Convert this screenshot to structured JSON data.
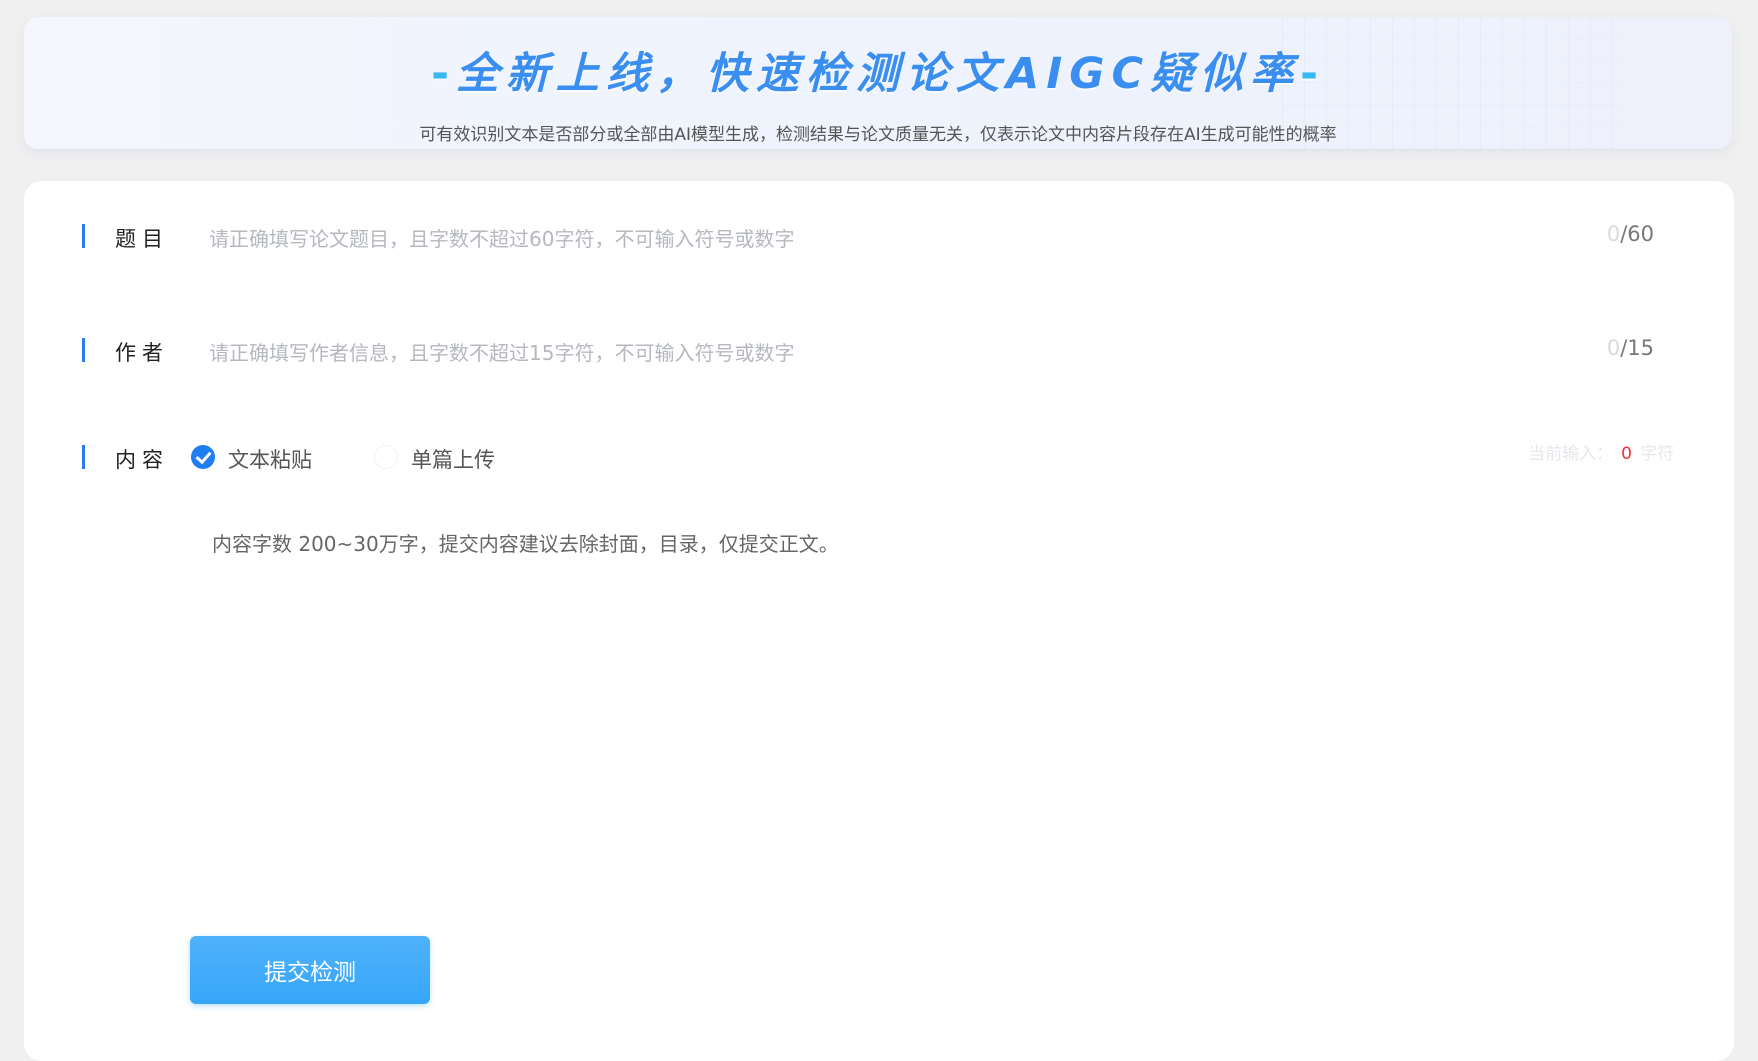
{
  "banner": {
    "title_dash_left": "-",
    "title": "全新上线，快速检测论文AIGC疑似率",
    "title_dash_right": "-",
    "subtitle": "可有效识别文本是否部分或全部由AI模型生成，检测结果与论文质量无关，仅表示论文中内容片段存在AI生成可能性的概率"
  },
  "form": {
    "title_field": {
      "label": "题目",
      "placeholder": "请正确填写论文题目，且字数不超过60字符，不可输入符号或数字",
      "current": "0",
      "max": "/60"
    },
    "author_field": {
      "label": "作者",
      "placeholder": "请正确填写作者信息，且字数不超过15字符，不可输入符号或数字",
      "current": "0",
      "max": "/15"
    },
    "content_field": {
      "label": "内容",
      "options": [
        {
          "label": "文本粘贴",
          "selected": true
        },
        {
          "label": "单篇上传",
          "selected": false
        }
      ],
      "count_prefix": "当前输入：",
      "count_value": "0",
      "count_unit": "字符",
      "hint": "内容字数 200~30万字，提交内容建议去除封面，目录，仅提交正文。"
    },
    "submit_label": "提交检测"
  },
  "colors": {
    "accent": "#1f7ff0",
    "button": "#3aa8f8",
    "count_red": "#f5303a"
  }
}
